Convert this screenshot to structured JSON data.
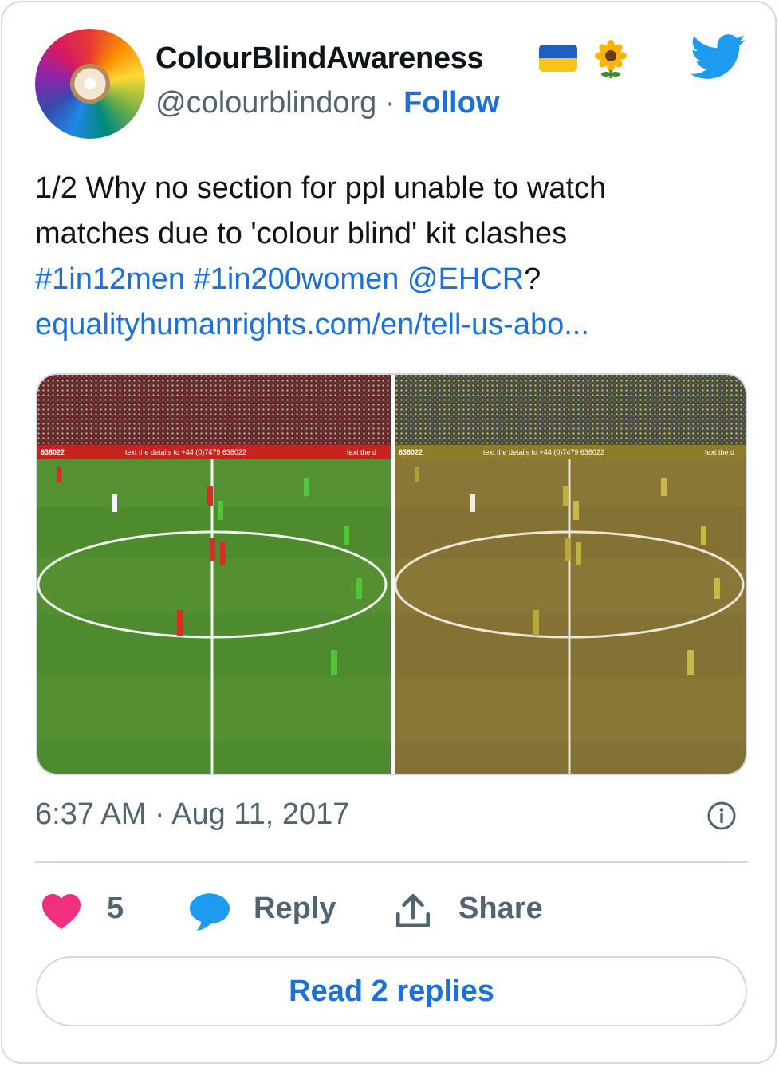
{
  "account": {
    "display_name": "ColourBlindAwareness",
    "handle": "@colourblindorg",
    "separator": "·",
    "follow_label": "Follow",
    "avatar_icon": "colored-pencils-avatar-icon",
    "badges": [
      "ukraine-flag-icon",
      "sunflower-icon"
    ],
    "platform_icon": "twitter-bird-icon"
  },
  "tweet": {
    "line1": "1/2 Why no section for ppl unable to watch",
    "line2": "matches due to 'colour blind' kit clashes",
    "hashtag1": "#1in12men",
    "hashtag2": "#1in200women",
    "mention": "@EHCR",
    "after_mention": "?",
    "url": "equalityhumanrights.com/en/tell-us-abo..."
  },
  "media": {
    "left_banner_a": "638022",
    "left_banner_b": "text the details to +44 (0)7479 638022",
    "left_banner_c": "text the d",
    "right_banner_a": "638022",
    "right_banner_b": "text the details to +44 (0)7479 638022",
    "right_banner_c": "text the d"
  },
  "meta": {
    "timestamp": "6:37 AM · Aug 11, 2017",
    "info_icon": "info-icon"
  },
  "actions": {
    "like_count": "5",
    "reply_label": "Reply",
    "share_label": "Share",
    "read_replies_label": "Read 2 replies"
  },
  "colors": {
    "link": "#1d70d8",
    "muted": "#536471",
    "heart": "#f0307f",
    "twitter_blue": "#1d9bf0",
    "border": "#cfd9de"
  }
}
